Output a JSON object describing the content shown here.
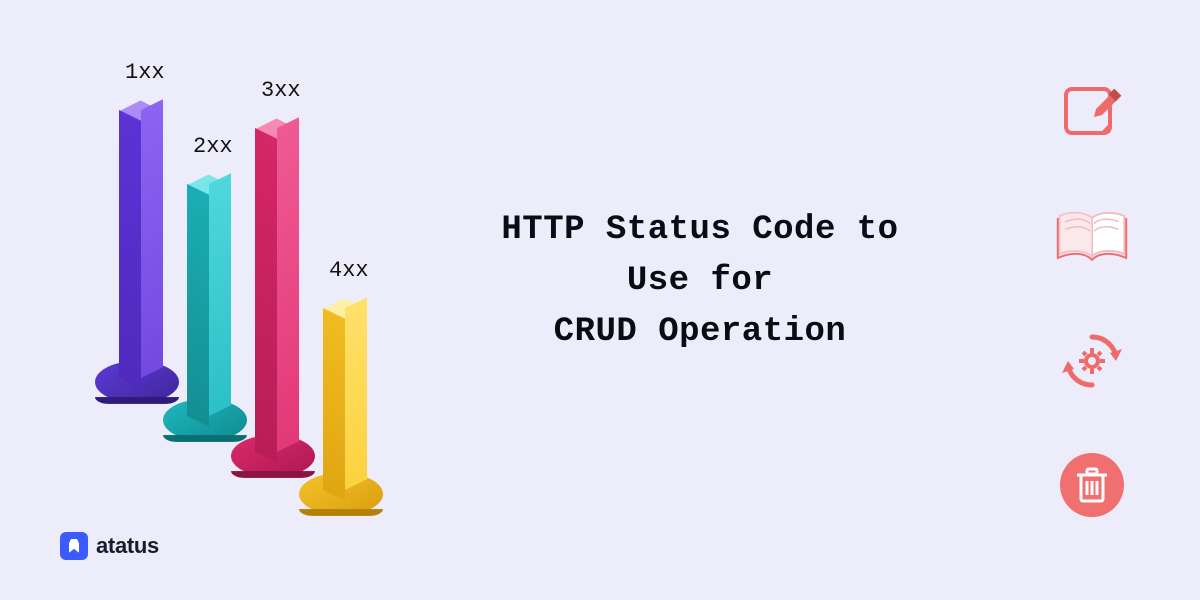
{
  "title": {
    "line1": "HTTP Status Code to",
    "line2": "Use for",
    "line3": "CRUD Operation"
  },
  "logo": {
    "text": "atatus"
  },
  "bars": [
    {
      "label": "1xx",
      "color": "purple"
    },
    {
      "label": "2xx",
      "color": "teal"
    },
    {
      "label": "3xx",
      "color": "pink"
    },
    {
      "label": "4xx",
      "color": "yellow"
    }
  ],
  "crud": {
    "create": "Create",
    "read": "Read",
    "update": "Update",
    "delete": "Delete"
  },
  "colors": {
    "accent_coral": "#ef6a6a",
    "accent_pink": "#f5b9c1",
    "bg": "#ECECFA"
  }
}
